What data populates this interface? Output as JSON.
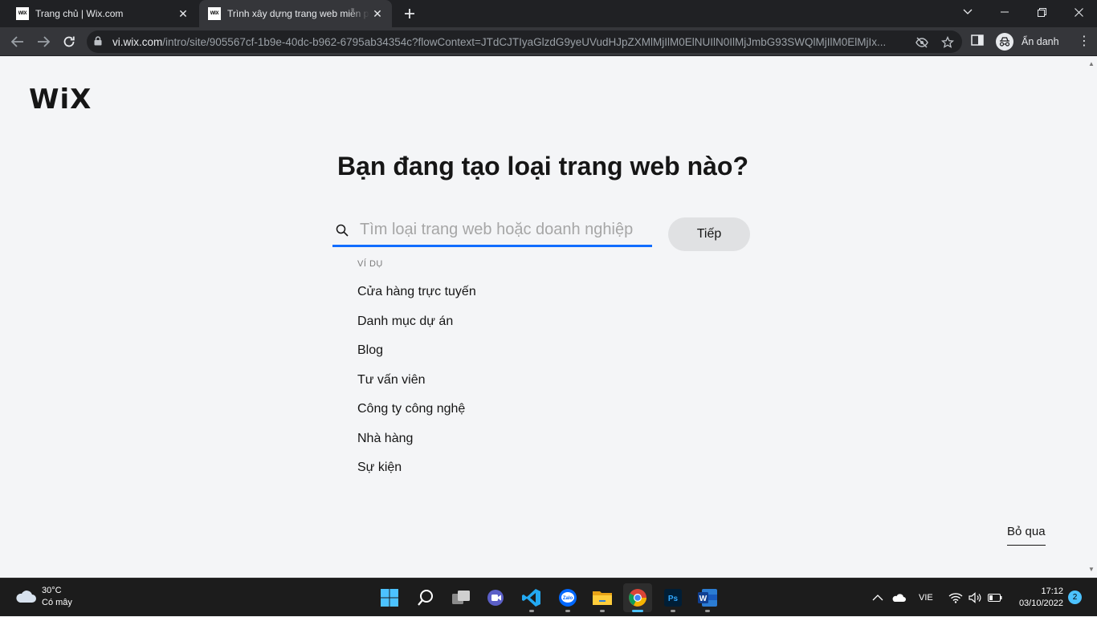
{
  "browser": {
    "tabs": [
      {
        "favicon": "WIX",
        "title": "Trang chủ | Wix.com",
        "active": false
      },
      {
        "favicon": "WIX",
        "title": "Trình xây dựng trang web miễn phí",
        "active": true
      }
    ],
    "new_tab_icon": "plus-icon",
    "window_controls": [
      "chevron-down-icon",
      "minimize-icon",
      "restore-icon",
      "close-icon"
    ],
    "url_host": "vi.wix.com",
    "url_path": "/intro/site/905567cf-1b9e-40dc-b962-6795ab34354c?flowContext=JTdCJTIyaGlzdG9yeUVudHJpZXMlMjIlM0ElNUIlN0IlMjJmbG93SWQlMjIlM0ElMjIx...",
    "profile_label": "Ẩn danh"
  },
  "page": {
    "logo": "WiX",
    "headline": "Bạn đang tạo loại trang web nào?",
    "search": {
      "placeholder": "Tìm loại trang web hoặc doanh nghiệp",
      "value": ""
    },
    "next_button": "Tiếp",
    "examples_label": "VÍ DỤ",
    "examples": [
      "Cửa hàng trực tuyến",
      "Danh mục dự án",
      "Blog",
      "Tư vấn viên",
      "Công ty công nghệ",
      "Nhà hàng",
      "Sự kiện"
    ],
    "skip_link": "Bỏ qua"
  },
  "taskbar": {
    "weather_temp": "30°C",
    "weather_desc": "Có mây",
    "apps": [
      "start",
      "search",
      "task-view",
      "meet",
      "vscode",
      "zalo",
      "file-explorer",
      "chrome",
      "photoshop",
      "word"
    ],
    "language": "VIE",
    "time": "17:12",
    "date": "03/10/2022",
    "notifications": "2",
    "accent": "#4cc2ff"
  },
  "colors": {
    "accent_blue": "#116dff",
    "page_bg": "#f4f5f7",
    "button_bg": "#e0e1e3"
  }
}
